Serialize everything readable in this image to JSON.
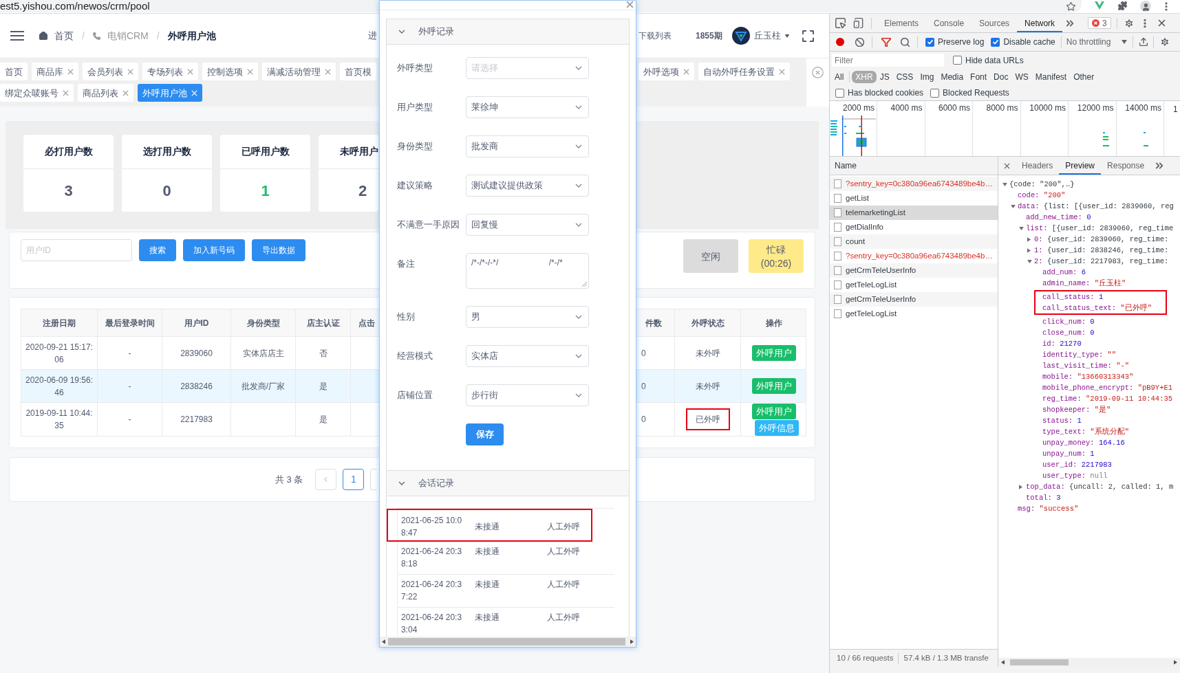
{
  "browser": {
    "url": "est5.yishou.com/newos/crm/pool"
  },
  "header": {
    "breadcrumb": [
      {
        "label": "首页",
        "kind": "home",
        "link": true,
        "current": false
      },
      {
        "separator": "/",
        "label": "电销CRM",
        "kind": "phone",
        "link": false,
        "current": false
      },
      {
        "separator": "/",
        "label": "外呼用户池",
        "link": false,
        "current": true
      }
    ],
    "cut_item": "进",
    "download_list": "下载列表",
    "period": "1855期",
    "user": "丘玉柱"
  },
  "tabs": {
    "row_1_left": [
      {
        "label": "首页",
        "closable": false,
        "selected": false
      },
      {
        "label": "商品库",
        "closable": true,
        "selected": false
      },
      {
        "label": "会员列表",
        "closable": true,
        "selected": false
      },
      {
        "label": "专场列表",
        "closable": true,
        "selected": false
      },
      {
        "label": "控制选项",
        "closable": true,
        "selected": false
      },
      {
        "label": "满减活动管理",
        "closable": true,
        "selected": false
      },
      {
        "label": "首页模",
        "closable": false,
        "selected": false
      }
    ],
    "row_1_right": [
      {
        "label": "外呼选项",
        "closable": true,
        "selected": false
      },
      {
        "label": "自动外呼任务设置",
        "closable": true,
        "selected": false
      }
    ],
    "row_2": [
      {
        "label": "绑定众唛账号",
        "closable": true,
        "selected": false
      },
      {
        "label": "商品列表",
        "closable": true,
        "selected": false
      },
      {
        "label": "外呼用户池",
        "closable": true,
        "selected": true
      }
    ]
  },
  "stats": [
    {
      "label": "必打用户数",
      "value": "3",
      "color": "#515a6e",
      "clipped": false
    },
    {
      "label": "选打用户数",
      "value": "0",
      "color": "#515a6e",
      "clipped": false
    },
    {
      "label": "已呼用户数",
      "value": "1",
      "color": "#19be6b",
      "clipped": false
    },
    {
      "label": "未呼用户",
      "value": "2",
      "color": "#515a6e",
      "clipped": true
    }
  ],
  "search": {
    "placeholder": "用户ID",
    "buttons": [
      "搜索",
      "加入新号码",
      "导出数据"
    ]
  },
  "agent_status": [
    {
      "label": "空闲",
      "selected": false
    },
    {
      "label": "忙碌",
      "timer": "(00:26)",
      "selected": true
    }
  ],
  "table": {
    "columns_left": [
      "注册日期",
      "最后登录时间",
      "用户ID",
      "身份类型",
      "店主认证",
      "点击"
    ],
    "columns_right": [
      "件数",
      "外呼状态",
      "操作"
    ],
    "rows": [
      {
        "selected": false,
        "reg_date": "2020-09-21 15:17:06",
        "last_login": "-",
        "user_id": "2839060",
        "identity": "实体店店主",
        "shopkeeper": "否",
        "column_7": "0",
        "status": "未外呼",
        "status_annotated": false,
        "actions": [
          {
            "label": "外呼用户",
            "kind": "call"
          }
        ]
      },
      {
        "selected": true,
        "reg_date": "2020-06-09 19:56:46",
        "last_login": "-",
        "user_id": "2838246",
        "identity": "批发商/厂家",
        "shopkeeper": "是",
        "column_7": "0",
        "status": "未外呼",
        "status_annotated": false,
        "actions": [
          {
            "label": "外呼用户",
            "kind": "call"
          }
        ]
      },
      {
        "selected": false,
        "reg_date": "2019-09-11 10:44:35",
        "last_login": "-",
        "user_id": "2217983",
        "shopkeeper": "是",
        "column_7": "0",
        "status": "已外呼",
        "status_annotated": true,
        "actions": [
          {
            "label": "外呼用户",
            "kind": "call"
          },
          {
            "label": "外呼信息",
            "kind": "info"
          }
        ]
      }
    ]
  },
  "pagination": {
    "total": "共 3 条",
    "prev_disabled": true,
    "pages": [
      {
        "label": "1",
        "selected": true
      }
    ]
  },
  "modal": {
    "sections": [
      {
        "title": "外呼记录",
        "expanded": true,
        "kind": "form",
        "fields": [
          {
            "label": "外呼类型",
            "kind": "select",
            "placeholder": "请选择"
          },
          {
            "label": "用户类型",
            "kind": "select",
            "value": "莱徐坤"
          },
          {
            "label": "身份类型",
            "kind": "select",
            "value": "批发商"
          },
          {
            "label": "建议策略",
            "kind": "select",
            "value": "测试建议提供政策"
          },
          {
            "label": "不满意一手原因",
            "kind": "select",
            "value": "回复慢"
          },
          {
            "label": "备注",
            "kind": "textarea",
            "value": "/*-/*-/-*/                      /*-/*"
          },
          {
            "label": "性别",
            "kind": "select",
            "value": "男"
          },
          {
            "label": "经营模式",
            "kind": "select",
            "value": "实体店"
          },
          {
            "label": "店铺位置",
            "kind": "select",
            "value": "步行街"
          }
        ],
        "submit": "保存"
      },
      {
        "title": "会话记录",
        "expanded": true,
        "kind": "records",
        "records": [
          {
            "time": "2021-06-25 10:08:47",
            "result": "未接通",
            "type": "人工外呼",
            "annotated": true
          },
          {
            "time": "2021-06-24 20:38:18",
            "result": "未接通",
            "type": "人工外呼",
            "annotated": false
          },
          {
            "time": "2021-06-24 20:37:22",
            "result": "未接通",
            "type": "人工外呼",
            "annotated": false
          },
          {
            "time": "2021-06-24 20:33:04",
            "result": "未接通",
            "type": "人工外呼",
            "annotated": false
          }
        ]
      }
    ]
  },
  "devtools": {
    "panels": [
      {
        "label": "Elements",
        "selected": false
      },
      {
        "label": "Console",
        "selected": false
      },
      {
        "label": "Sources",
        "selected": false
      },
      {
        "label": "Network",
        "selected": true
      }
    ],
    "error_count": "3",
    "toolbar": {
      "recording": true,
      "filter_active": true,
      "options": [
        {
          "label": "Preserve log",
          "checked": true
        },
        {
          "label": "Disable cache",
          "checked": true
        }
      ],
      "throttling": "No throttling"
    },
    "filter": {
      "placeholder": "Filter",
      "options": [
        {
          "label": "Hide data URLs",
          "checked": false
        }
      ]
    },
    "types": [
      {
        "label": "All",
        "selected": false
      },
      {
        "label": "XHR",
        "selected": true
      },
      {
        "label": "JS",
        "selected": false
      },
      {
        "label": "CSS",
        "selected": false
      },
      {
        "label": "Img",
        "selected": false
      },
      {
        "label": "Media",
        "selected": false
      },
      {
        "label": "Font",
        "selected": false
      },
      {
        "label": "Doc",
        "selected": false
      },
      {
        "label": "WS",
        "selected": false
      },
      {
        "label": "Manifest",
        "selected": false
      },
      {
        "label": "Other",
        "selected": false
      }
    ],
    "blocked": [
      {
        "label": "Has blocked cookies",
        "checked": false
      },
      {
        "label": "Blocked Requests",
        "checked": false
      }
    ],
    "timeline_ticks": [
      "2000 ms",
      "4000 ms",
      "6000 ms",
      "8000 ms",
      "10000 ms",
      "12000 ms",
      "14000 ms",
      "1"
    ],
    "name_header": "Name",
    "requests": [
      {
        "name": "?sentry_key=0c380a96ea6743489be4b…",
        "failed": true,
        "selected": false
      },
      {
        "name": "getList",
        "failed": false,
        "selected": false
      },
      {
        "name": "telemarketingList",
        "failed": false,
        "selected": true
      },
      {
        "name": "getDialInfo",
        "failed": false,
        "selected": false
      },
      {
        "name": "count",
        "failed": false,
        "selected": false
      },
      {
        "name": "?sentry_key=0c380a96ea6743489be4b…",
        "failed": true,
        "selected": false
      },
      {
        "name": "getCrmTeleUserInfo",
        "failed": false,
        "selected": false
      },
      {
        "name": "getTeleLogList",
        "failed": false,
        "selected": false
      },
      {
        "name": "getCrmTeleUserInfo",
        "failed": false,
        "selected": false
      },
      {
        "name": "getTeleLogList",
        "failed": false,
        "selected": false
      }
    ],
    "summary": [
      "10 / 66 requests",
      "57.4 kB / 1.3 MB transfe"
    ],
    "detail_tabs": [
      {
        "label": "Headers",
        "selected": false
      },
      {
        "label": "Preview",
        "selected": true
      },
      {
        "label": "Response",
        "selected": false
      }
    ],
    "preview": {
      "value": "{code: \"200\",…}",
      "kind": "object",
      "expanded": true,
      "children": [
        {
          "key": "code:",
          "value": "\"200\"",
          "kind": "string"
        },
        {
          "key": "data:",
          "value": "{list: [{user_id: 2839060, reg",
          "kind": "object",
          "expanded": true,
          "children": [
            {
              "key": "add_new_time:",
              "value": "0",
              "kind": "number"
            },
            {
              "key": "list:",
              "value": "[{user_id: 2839060, reg_time",
              "kind": "object",
              "expanded": true,
              "children": [
                {
                  "key": "0:",
                  "value": "{user_id: 2839060, reg_time:",
                  "kind": "object",
                  "expanded": false
                },
                {
                  "key": "1:",
                  "value": "{user_id: 2838246, reg_time:",
                  "kind": "object",
                  "expanded": false
                },
                {
                  "key": "2:",
                  "value": "{user_id: 2217983, reg_time:",
                  "kind": "object",
                  "expanded": true,
                  "children": [
                    {
                      "key": "add_num:",
                      "value": "6",
                      "kind": "number"
                    },
                    {
                      "key": "admin_name:",
                      "value": "\"丘玉柱\"",
                      "kind": "string"
                    },
                    {
                      "key": "call_status:",
                      "value": "1",
                      "kind": "number",
                      "annotated": true
                    },
                    {
                      "key": "call_status_text:",
                      "value": "\"已外呼\"",
                      "kind": "string",
                      "annotated": true
                    },
                    {
                      "key": "click_num:",
                      "value": "0",
                      "kind": "number"
                    },
                    {
                      "key": "close_num:",
                      "value": "0",
                      "kind": "number"
                    },
                    {
                      "key": "id:",
                      "value": "21270",
                      "kind": "number"
                    },
                    {
                      "key": "identity_type:",
                      "value": "\"\"",
                      "kind": "string"
                    },
                    {
                      "key": "last_visit_time:",
                      "value": "\"-\"",
                      "kind": "string"
                    },
                    {
                      "key": "mobile:",
                      "value": "\"13660313343\"",
                      "kind": "string"
                    },
                    {
                      "key": "mobile_phone_encrypt:",
                      "value": "\"pB9Y+E1",
                      "kind": "string"
                    },
                    {
                      "key": "reg_time:",
                      "value": "\"2019-09-11 10:44:35",
                      "kind": "string"
                    },
                    {
                      "key": "shopkeeper:",
                      "value": "\"是\"",
                      "kind": "string"
                    },
                    {
                      "key": "status:",
                      "value": "1",
                      "kind": "number"
                    },
                    {
                      "key": "type_text:",
                      "value": "\"系统分配\"",
                      "kind": "string"
                    },
                    {
                      "key": "unpay_money:",
                      "value": "164.16",
                      "kind": "number"
                    },
                    {
                      "key": "unpay_num:",
                      "value": "1",
                      "kind": "number"
                    },
                    {
                      "key": "user_id:",
                      "value": "2217983",
                      "kind": "number"
                    },
                    {
                      "key": "user_type:",
                      "value": "null",
                      "kind": "null"
                    }
                  ]
                }
              ]
            },
            {
              "key": "top_data:",
              "value": "{uncall: 2, called: 1, m",
              "kind": "object",
              "expanded": false
            },
            {
              "key": "total:",
              "value": "3",
              "kind": "number"
            }
          ]
        },
        {
          "key": "msg:",
          "value": "\"success\"",
          "kind": "string"
        }
      ]
    }
  }
}
